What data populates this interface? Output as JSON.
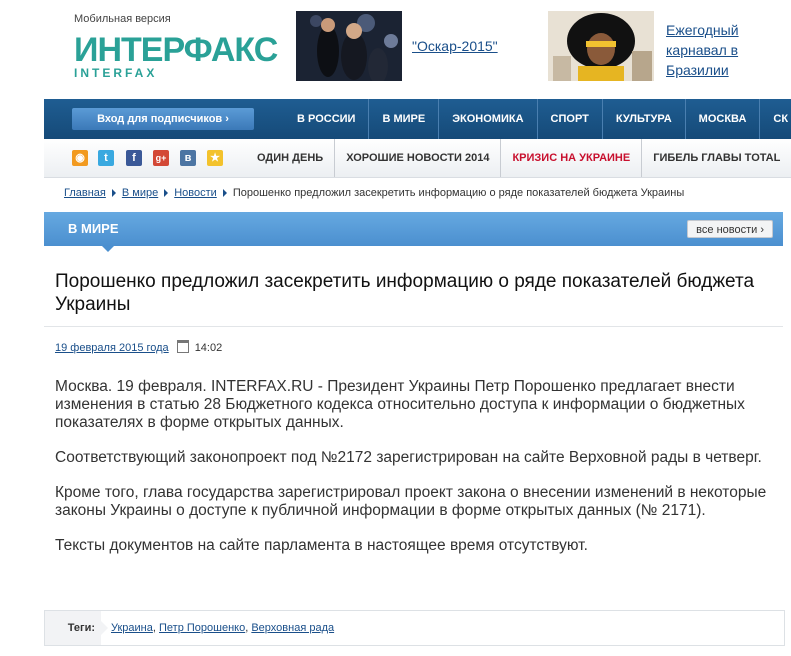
{
  "header": {
    "mobile_link": "Мобильная версия",
    "logo_main": "ИНТЕРФАКС",
    "logo_sub": "INTERFAX",
    "brand_color": "#2aa197",
    "promos": [
      {
        "text": "\"Оскар-2015\""
      },
      {
        "text": "Ежегодный карнавал в Бразилии"
      }
    ]
  },
  "main_nav": {
    "login_label": "Вход для подписчиков ›",
    "items": [
      "В РОССИИ",
      "В МИРЕ",
      "ЭКОНОМИКА",
      "СПОРТ",
      "КУЛЬТУРА",
      "МОСКВА",
      "СК"
    ]
  },
  "sub_nav": {
    "social_icons": [
      "rss-icon",
      "twitter-icon",
      "facebook-icon",
      "googleplus-icon",
      "vk-icon",
      "favorite-icon"
    ],
    "items": [
      "ОДИН ДЕНЬ",
      "ХОРОШИЕ НОВОСТИ 2014",
      "КРИЗИС НА УКРАИНЕ",
      "ГИБЕЛЬ ГЛАВЫ TOTAL"
    ]
  },
  "breadcrumb": {
    "items": [
      "Главная",
      "В мире",
      "Новости"
    ],
    "current": "Порошенко предложил засекретить информацию о ряде показателей бюджета Украины"
  },
  "section": {
    "title": "В МИРЕ",
    "all_news_label": "все новости ›"
  },
  "article": {
    "title": "Порошенко предложил засекретить информацию о ряде показателей бюджета Украины",
    "date": "19 февраля 2015 года",
    "time": "14:02",
    "paragraphs": [
      "Москва. 19 февраля. INTERFAX.RU - Президент Украины Петр Порошенко предлагает внести изменения в статью 28 Бюджетного кодекса относительно доступа к информации о бюджетных показателях в форме открытых данных.",
      "Соответствующий законопроект под №2172 зарегистрирован на сайте Верховной рады в четверг.",
      "Кроме того, глава государства зарегистрировал проект закона о внесении изменений в некоторые законы Украины о доступе к публичной информации в форме открытых данных (№ 2171).",
      "Тексты документов на сайте парламента в настоящее время отсутствуют."
    ]
  },
  "tags": {
    "label": "Теги:",
    "items": [
      "Украина",
      "Петр Порошенко",
      "Верховная рада"
    ]
  }
}
